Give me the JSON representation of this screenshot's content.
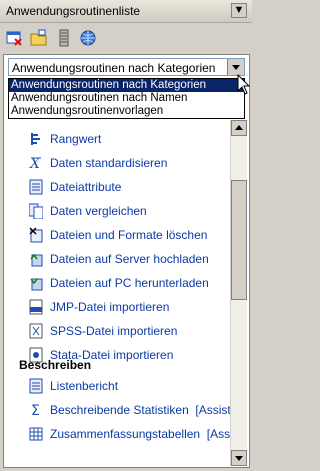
{
  "title": "Anwendungsroutinenliste",
  "title_button": "▼",
  "toolbar": {
    "buttons": [
      "routine-manager-icon",
      "open-folder-icon",
      "routine-list-icon",
      "globe-icon"
    ]
  },
  "dropdown": {
    "selected": "Anwendungsroutinen nach Kategorien",
    "options": [
      "Anwendungsroutinen nach Kategorien",
      "Anwendungsroutinen nach Namen",
      "Anwendungsroutinenvorlagen"
    ]
  },
  "items": [
    {
      "label": "Rangwert",
      "icon": "rank-icon"
    },
    {
      "label": "Daten standardisieren",
      "icon": "standardize-icon"
    },
    {
      "label": "Dateiattribute",
      "icon": "file-attributes-icon"
    },
    {
      "label": "Daten vergleichen",
      "icon": "compare-icon"
    },
    {
      "label": "Dateien und Formate löschen",
      "icon": "delete-files-icon"
    },
    {
      "label": "Dateien auf Server hochladen",
      "icon": "upload-server-icon"
    },
    {
      "label": "Dateien auf PC herunterladen",
      "icon": "download-pc-icon"
    },
    {
      "label": "JMP-Datei importieren",
      "icon": "jmp-import-icon"
    },
    {
      "label": "SPSS-Datei importieren",
      "icon": "spss-import-icon"
    },
    {
      "label": "Stata-Datei importieren",
      "icon": "stata-import-icon"
    }
  ],
  "section_describe": "Beschreiben",
  "items_describe": [
    {
      "label": "Listenbericht",
      "extra": "",
      "icon": "list-report-icon"
    },
    {
      "label": "Beschreibende Statistiken",
      "extra": "[Assistent v",
      "icon": "sigma-icon"
    },
    {
      "label": "Zusammenfassungstabellen",
      "extra": "[Assisten",
      "icon": "summary-table-icon"
    }
  ]
}
